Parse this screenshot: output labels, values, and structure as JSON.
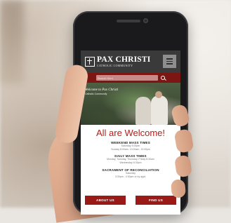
{
  "site": {
    "logo_title": "PAX CHRISTI",
    "logo_subtitle": "CATHOLIC COMMUNITY",
    "search_placeholder": "Search Here",
    "hero_title": "Welcome to Pax Christi",
    "hero_subtitle": "Catholic Community"
  },
  "content": {
    "heading": "All are Welcome!",
    "sections": [
      {
        "title": "WEEKEND MASS TIMES",
        "lines": [
          "Saturday 5:00pm",
          "Sunday 8:00am, 10:00am, 12:00pm"
        ]
      },
      {
        "title": "DAILY MASS TIMES",
        "lines": [
          "Monday, Tuesday, Thursday, Friday 8:30am",
          "Wednesday 6:30pm"
        ]
      },
      {
        "title": "SACRAMENT OF RECONCILIATION",
        "lines": [
          "Saturday",
          "3:30pm - 4:30pm or by appt."
        ]
      }
    ]
  },
  "buttons": {
    "about": "ABOUT US",
    "find": "FIND US"
  },
  "colors": {
    "brand_red": "#9a1a18",
    "header": "#3a3a3a"
  }
}
